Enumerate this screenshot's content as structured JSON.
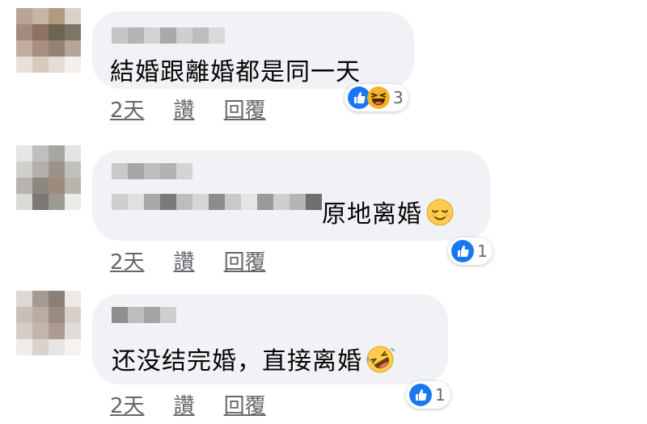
{
  "comments": [
    {
      "text": "結婚跟離婚都是同一天",
      "time": "2天",
      "like_label": "讚",
      "reply_label": "回覆",
      "reaction_count": "3",
      "reactions": [
        "like-icon",
        "laughing-icon"
      ],
      "inline_emoji": ""
    },
    {
      "text": "原地离婚",
      "time": "2天",
      "like_label": "讚",
      "reply_label": "回覆",
      "reaction_count": "1",
      "reactions": [
        "like-icon"
      ],
      "inline_emoji": "relieved-face-icon"
    },
    {
      "text": "还没结完婚，直接离婚",
      "time": "2天",
      "like_label": "讚",
      "reply_label": "回覆",
      "reaction_count": "1",
      "reactions": [
        "like-icon"
      ],
      "inline_emoji": "rolling-on-floor-laughing-icon"
    }
  ],
  "colors": {
    "bubble": "#f0f2f5",
    "like_blue": "#1877f2",
    "meta_gray": "#65676b"
  }
}
